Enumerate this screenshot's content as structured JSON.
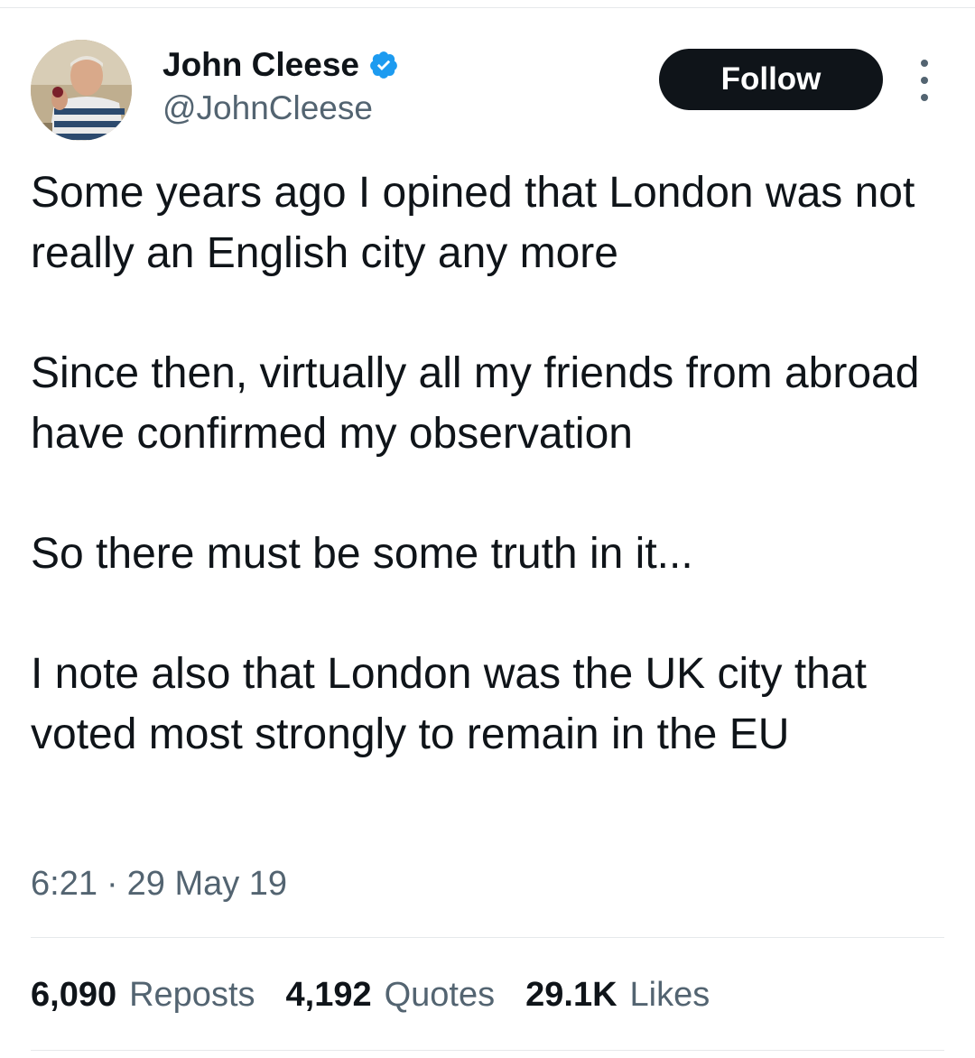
{
  "author": {
    "display_name": "John Cleese",
    "handle": "@JohnCleese",
    "verified_icon": "verified-badge-icon"
  },
  "actions": {
    "follow_label": "Follow",
    "more_icon": "more-options-icon"
  },
  "tweet": {
    "paragraphs": [
      "Some years ago I opined that London was not really an English city any more",
      "Since then, virtually all my friends from abroad have confirmed my observation",
      "So there must be some truth in it...",
      "I note also that London was the UK city that voted most strongly to remain in the EU"
    ],
    "time": "6:21",
    "separator": "·",
    "date": "29 May 19"
  },
  "stats": [
    {
      "value": "6,090",
      "label": "Reposts"
    },
    {
      "value": "4,192",
      "label": "Quotes"
    },
    {
      "value": "29.1K",
      "label": "Likes"
    }
  ],
  "colors": {
    "text_primary": "#0f1419",
    "text_secondary": "#536471",
    "verified_blue": "#1d9bf0",
    "divider": "#e6e9eb",
    "follow_bg": "#0f1419"
  }
}
